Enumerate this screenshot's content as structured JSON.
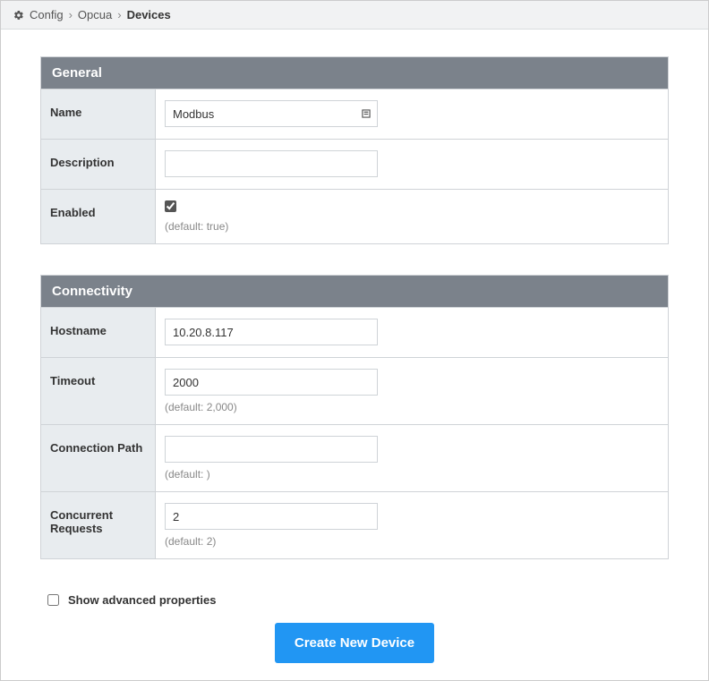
{
  "breadcrumb": {
    "items": [
      {
        "label": "Config"
      },
      {
        "label": "Opcua"
      },
      {
        "label": "Devices"
      }
    ]
  },
  "sections": {
    "general": {
      "title": "General",
      "fields": {
        "name": {
          "label": "Name",
          "value": "Modbus"
        },
        "description": {
          "label": "Description",
          "value": ""
        },
        "enabled": {
          "label": "Enabled",
          "checked": true,
          "hint": "(default: true)"
        }
      }
    },
    "connectivity": {
      "title": "Connectivity",
      "fields": {
        "hostname": {
          "label": "Hostname",
          "value": "10.20.8.117"
        },
        "timeout": {
          "label": "Timeout",
          "value": "2000",
          "hint": "(default: 2,000)"
        },
        "conn_path": {
          "label": "Connection Path",
          "value": "",
          "hint": "(default: )"
        },
        "concurrent": {
          "label": "Concurrent Requests",
          "value": "2",
          "hint": "(default: 2)"
        }
      }
    }
  },
  "advanced": {
    "label": "Show advanced properties",
    "checked": false
  },
  "actions": {
    "create": "Create New Device"
  }
}
